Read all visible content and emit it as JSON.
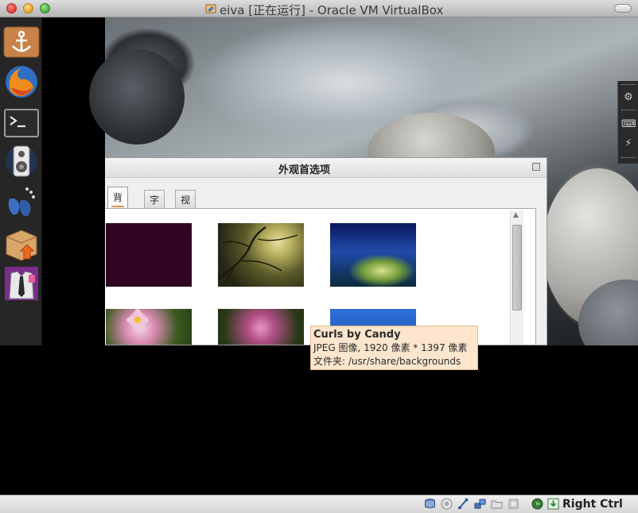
{
  "window": {
    "title": "eiva [正在运行] - Oracle VM VirtualBox"
  },
  "dialog": {
    "title": "外观首选项",
    "tabs": [
      {
        "label": "背景",
        "active": true
      },
      {
        "label": "字体",
        "active": false
      },
      {
        "label": "视觉效果",
        "active": false
      }
    ]
  },
  "tooltip": {
    "title": "Curls by Candy",
    "info": "JPEG 图像, 1920 像素 * 1397 像素",
    "folder": "文件夹: /usr/share/backgrounds"
  },
  "statusbar": {
    "host_key": "Right Ctrl"
  },
  "colors": {
    "tooltip_bg": "#fde6cd",
    "accent_tab": "#e58f5a",
    "launcher_bg": "#262626"
  }
}
